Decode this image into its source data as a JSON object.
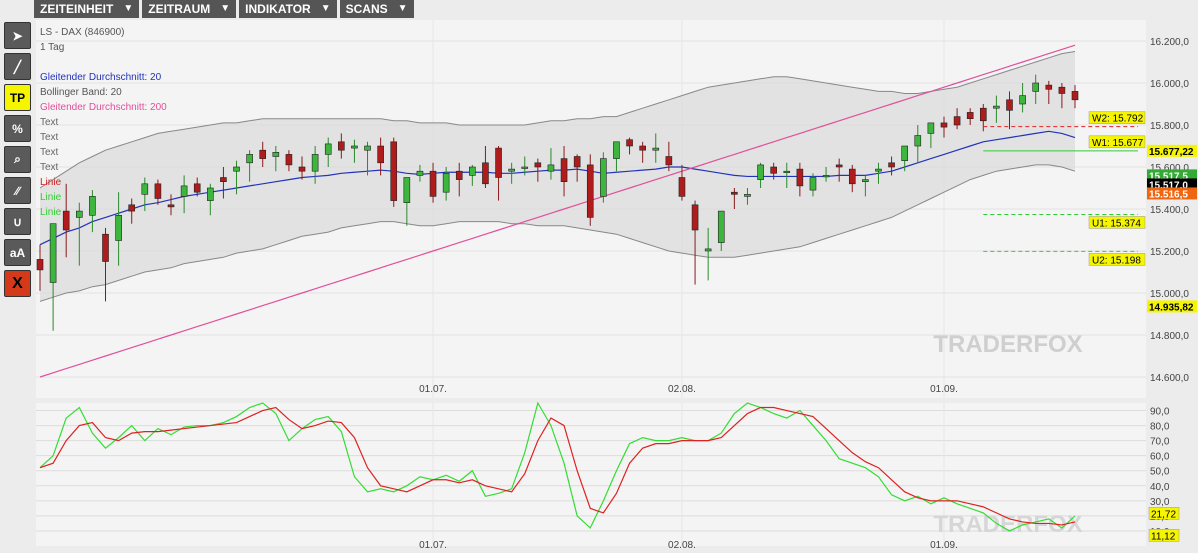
{
  "menus": [
    {
      "label": "ZEITEINHEIT",
      "name": "menu-zeiteinheit"
    },
    {
      "label": "ZEITRAUM",
      "name": "menu-zeitraum"
    },
    {
      "label": "INDIKATOR",
      "name": "menu-indikator"
    },
    {
      "label": "SCANS",
      "name": "menu-scans"
    }
  ],
  "tools": [
    {
      "name": "cursor-tool-icon",
      "glyph": "➤"
    },
    {
      "name": "line-tool-icon",
      "glyph": "╱"
    },
    {
      "name": "tp-tool-button",
      "glyph": "TP",
      "style": "tp"
    },
    {
      "name": "percent-tool-icon",
      "glyph": "%"
    },
    {
      "name": "zoom-tool-icon",
      "glyph": "⌕"
    },
    {
      "name": "channel-tool-icon",
      "glyph": "∕∕"
    },
    {
      "name": "curve-tool-icon",
      "glyph": "∪"
    },
    {
      "name": "text-size-tool-button",
      "glyph": "aA"
    },
    {
      "name": "delete-tool-icon",
      "glyph": "X",
      "style": "del"
    }
  ],
  "instrument": {
    "title": "LS - DAX (846900)",
    "period": "1 Tag"
  },
  "legend": [
    {
      "text": "Gleitender Durchschnitt: 20",
      "color": "#2233bb"
    },
    {
      "text": "Bollinger Band: 20",
      "color": "#555555"
    },
    {
      "text": "Gleitender Durchschnitt: 200",
      "color": "#e0509a"
    },
    {
      "text": "Text",
      "color": "#666666"
    },
    {
      "text": "Text",
      "color": "#666666"
    },
    {
      "text": "Text",
      "color": "#666666"
    },
    {
      "text": "Text",
      "color": "#666666"
    },
    {
      "text": "Linie",
      "color": "#cc2222"
    },
    {
      "text": "Linie",
      "color": "#33cc33"
    },
    {
      "text": "Linie",
      "color": "#33cc33"
    }
  ],
  "watermark": "TRADERFOX",
  "chart_data": [
    {
      "type": "candlestick",
      "ylim": [
        14500,
        16300
      ],
      "yticks": [
        {
          "v": 16200,
          "l": "16.200,0"
        },
        {
          "v": 16000,
          "l": "16.000,0"
        },
        {
          "v": 15800,
          "l": "15.800,0"
        },
        {
          "v": 15600,
          "l": "15.600,0"
        },
        {
          "v": 15400,
          "l": "15.400,0"
        },
        {
          "v": 15200,
          "l": "15.200,0"
        },
        {
          "v": 15000,
          "l": "15.000,0"
        },
        {
          "v": 14800,
          "l": "14.800,0"
        },
        {
          "v": 14600,
          "l": "14.600,0"
        }
      ],
      "xticks": [
        {
          "i": 30,
          "l": "01.07."
        },
        {
          "i": 49,
          "l": "02.08."
        },
        {
          "i": 69,
          "l": "01.09."
        }
      ],
      "n": 80,
      "ohlc": [
        [
          15160,
          15230,
          15010,
          15110
        ],
        [
          15050,
          15280,
          14820,
          15330
        ],
        [
          15390,
          15520,
          15170,
          15300
        ],
        [
          15360,
          15430,
          15130,
          15390
        ],
        [
          15370,
          15490,
          15290,
          15460
        ],
        [
          15280,
          15310,
          14960,
          15150
        ],
        [
          15250,
          15480,
          15130,
          15370
        ],
        [
          15420,
          15450,
          15330,
          15390
        ],
        [
          15470,
          15550,
          15390,
          15520
        ],
        [
          15520,
          15540,
          15420,
          15450
        ],
        [
          15420,
          15470,
          15370,
          15410
        ],
        [
          15460,
          15560,
          15380,
          15510
        ],
        [
          15520,
          15550,
          15460,
          15480
        ],
        [
          15440,
          15520,
          15370,
          15500
        ],
        [
          15550,
          15600,
          15450,
          15530
        ],
        [
          15580,
          15630,
          15470,
          15600
        ],
        [
          15620,
          15680,
          15530,
          15660
        ],
        [
          15680,
          15720,
          15600,
          15640
        ],
        [
          15650,
          15700,
          15580,
          15670
        ],
        [
          15660,
          15680,
          15580,
          15610
        ],
        [
          15600,
          15650,
          15540,
          15580
        ],
        [
          15580,
          15700,
          15520,
          15660
        ],
        [
          15660,
          15740,
          15600,
          15710
        ],
        [
          15720,
          15760,
          15640,
          15680
        ],
        [
          15690,
          15730,
          15620,
          15700
        ],
        [
          15680,
          15720,
          15560,
          15700
        ],
        [
          15700,
          15740,
          15560,
          15620
        ],
        [
          15720,
          15740,
          15410,
          15440
        ],
        [
          15430,
          15470,
          15320,
          15550
        ],
        [
          15560,
          15610,
          15530,
          15580
        ],
        [
          15580,
          15620,
          15430,
          15460
        ],
        [
          15480,
          15600,
          15440,
          15570
        ],
        [
          15580,
          15620,
          15460,
          15540
        ],
        [
          15560,
          15610,
          15510,
          15600
        ],
        [
          15620,
          15700,
          15500,
          15520
        ],
        [
          15690,
          15700,
          15440,
          15550
        ],
        [
          15580,
          15620,
          15520,
          15590
        ],
        [
          15600,
          15650,
          15560,
          15600
        ],
        [
          15620,
          15640,
          15530,
          15600
        ],
        [
          15580,
          15690,
          15540,
          15610
        ],
        [
          15640,
          15700,
          15460,
          15530
        ],
        [
          15650,
          15660,
          15530,
          15600
        ],
        [
          15610,
          15660,
          15320,
          15360
        ],
        [
          15460,
          15670,
          15430,
          15640
        ],
        [
          15640,
          15710,
          15580,
          15720
        ],
        [
          15730,
          15740,
          15660,
          15700
        ],
        [
          15700,
          15720,
          15620,
          15680
        ],
        [
          15680,
          15760,
          15620,
          15690
        ],
        [
          15650,
          15720,
          15580,
          15610
        ],
        [
          15550,
          15610,
          15440,
          15460
        ],
        [
          15420,
          15440,
          15040,
          15300
        ],
        [
          15200,
          15310,
          15060,
          15210
        ],
        [
          15240,
          15380,
          15200,
          15390
        ],
        [
          15480,
          15500,
          15400,
          15470
        ],
        [
          15460,
          15500,
          15420,
          15470
        ],
        [
          15540,
          15620,
          15500,
          15610
        ],
        [
          15600,
          15620,
          15540,
          15570
        ],
        [
          15580,
          15620,
          15500,
          15580
        ],
        [
          15590,
          15620,
          15460,
          15510
        ],
        [
          15490,
          15570,
          15460,
          15550
        ],
        [
          15560,
          15600,
          15530,
          15560
        ],
        [
          15610,
          15640,
          15530,
          15600
        ],
        [
          15590,
          15610,
          15480,
          15520
        ],
        [
          15530,
          15560,
          15460,
          15540
        ],
        [
          15580,
          15620,
          15520,
          15590
        ],
        [
          15620,
          15650,
          15560,
          15600
        ],
        [
          15630,
          15700,
          15580,
          15700
        ],
        [
          15700,
          15800,
          15620,
          15750
        ],
        [
          15760,
          15800,
          15690,
          15810
        ],
        [
          15810,
          15840,
          15740,
          15790
        ],
        [
          15840,
          15880,
          15780,
          15800
        ],
        [
          15860,
          15880,
          15800,
          15830
        ],
        [
          15880,
          15900,
          15770,
          15820
        ],
        [
          15880,
          15940,
          15810,
          15890
        ],
        [
          15920,
          15960,
          15780,
          15870
        ],
        [
          15900,
          16000,
          15860,
          15940
        ],
        [
          15960,
          16040,
          15900,
          16000
        ],
        [
          15990,
          16010,
          15900,
          15970
        ],
        [
          15980,
          16000,
          15880,
          15950
        ],
        [
          15960,
          15990,
          15880,
          15920
        ]
      ]
    },
    {
      "type": "line",
      "name": "stochastic",
      "ylim": [
        0,
        95
      ],
      "yticks": [
        {
          "v": 90,
          "l": "90,0"
        },
        {
          "v": 80,
          "l": "80,0"
        },
        {
          "v": 70,
          "l": "70,0"
        },
        {
          "v": 60,
          "l": "60,0"
        },
        {
          "v": 50,
          "l": "50,0"
        },
        {
          "v": 40,
          "l": "40,0"
        },
        {
          "v": 30,
          "l": "30,0"
        },
        {
          "v": 20,
          "l": "20,0"
        },
        {
          "v": 10,
          "l": "10,0"
        }
      ],
      "series": [
        {
          "color": "#33dd33",
          "values": [
            52,
            60,
            85,
            92,
            75,
            65,
            72,
            80,
            70,
            78,
            74,
            79,
            80,
            80,
            82,
            86,
            92,
            95,
            88,
            70,
            78,
            84,
            86,
            76,
            46,
            36,
            38,
            36,
            40,
            46,
            44,
            47,
            43,
            50,
            33,
            35,
            38,
            62,
            95,
            80,
            55,
            20,
            12,
            30,
            50,
            68,
            72,
            70,
            70,
            72,
            70,
            70,
            75,
            88,
            95,
            92,
            88,
            85,
            90,
            80,
            70,
            58,
            55,
            52,
            46,
            34,
            30,
            33,
            28,
            32,
            28,
            25,
            22,
            15,
            10,
            14,
            16,
            18,
            12,
            20
          ]
        },
        {
          "color": "#dd2222",
          "values": [
            52,
            55,
            70,
            80,
            82,
            72,
            70,
            75,
            76,
            76,
            77,
            78,
            79,
            80,
            81,
            82,
            86,
            90,
            92,
            84,
            78,
            80,
            83,
            82,
            72,
            52,
            40,
            38,
            36,
            40,
            44,
            44,
            42,
            44,
            40,
            38,
            36,
            48,
            70,
            85,
            80,
            50,
            25,
            22,
            35,
            55,
            65,
            68,
            68,
            70,
            70,
            70,
            72,
            80,
            88,
            92,
            92,
            90,
            88,
            86,
            78,
            70,
            62,
            56,
            52,
            44,
            36,
            32,
            30,
            30,
            30,
            28,
            26,
            22,
            18,
            16,
            15,
            15,
            14,
            16
          ]
        }
      ]
    }
  ],
  "overlays": {
    "ma20": [
      15230,
      15260,
      15290,
      15310,
      15340,
      15360,
      15380,
      15400,
      15420,
      15430,
      15445,
      15460,
      15470,
      15480,
      15490,
      15500,
      15510,
      15520,
      15530,
      15540,
      15550,
      15555,
      15560,
      15570,
      15575,
      15580,
      15585,
      15580,
      15570,
      15565,
      15570,
      15575,
      15575,
      15575,
      15575,
      15570,
      15570,
      15575,
      15580,
      15585,
      15585,
      15590,
      15580,
      15570,
      15575,
      15580,
      15585,
      15590,
      15600,
      15600,
      15590,
      15580,
      15570,
      15560,
      15555,
      15555,
      15555,
      15555,
      15555,
      15555,
      15555,
      15560,
      15560,
      15560,
      15570,
      15580,
      15600,
      15620,
      15640,
      15660,
      15680,
      15700,
      15720,
      15730,
      15740,
      15750,
      15760,
      15770,
      15760,
      15740
    ],
    "boll_upper": [
      15500,
      15540,
      15580,
      15620,
      15650,
      15680,
      15700,
      15720,
      15740,
      15760,
      15770,
      15780,
      15790,
      15800,
      15810,
      15810,
      15820,
      15830,
      15830,
      15830,
      15830,
      15830,
      15830,
      15830,
      15830,
      15830,
      15830,
      15820,
      15820,
      15810,
      15810,
      15810,
      15800,
      15800,
      15800,
      15800,
      15800,
      15800,
      15810,
      15820,
      15820,
      15830,
      15830,
      15840,
      15840,
      15860,
      15880,
      15900,
      15920,
      15940,
      15960,
      15980,
      15990,
      16000,
      16010,
      16020,
      16030,
      16030,
      16020,
      16010,
      16000,
      15990,
      15980,
      15970,
      15960,
      15960,
      15950,
      15950,
      15960,
      15970,
      15980,
      16000,
      16020,
      16040,
      16060,
      16080,
      16100,
      16120,
      16140,
      16150
    ],
    "boll_lower": [
      14960,
      14980,
      15000,
      15010,
      15030,
      15040,
      15060,
      15080,
      15100,
      15110,
      15120,
      15140,
      15150,
      15160,
      15170,
      15190,
      15200,
      15210,
      15230,
      15250,
      15270,
      15280,
      15290,
      15310,
      15320,
      15330,
      15340,
      15340,
      15330,
      15320,
      15320,
      15330,
      15340,
      15340,
      15340,
      15340,
      15330,
      15330,
      15320,
      15320,
      15320,
      15310,
      15300,
      15290,
      15280,
      15260,
      15240,
      15220,
      15200,
      15190,
      15180,
      15170,
      15170,
      15170,
      15180,
      15190,
      15200,
      15210,
      15220,
      15240,
      15260,
      15280,
      15300,
      15320,
      15340,
      15360,
      15390,
      15420,
      15450,
      15480,
      15510,
      15540,
      15560,
      15580,
      15590,
      15600,
      15610,
      15610,
      15600,
      15580
    ],
    "ma200": [
      14600,
      14620,
      14640,
      14660,
      14680,
      14700,
      14720,
      14740,
      14760,
      14780,
      14800,
      14820,
      14840,
      14860,
      14880,
      14900,
      14920,
      14940,
      14960,
      14980,
      15000,
      15020,
      15040,
      15060,
      15080,
      15100,
      15120,
      15140,
      15160,
      15180,
      15200,
      15220,
      15240,
      15260,
      15280,
      15300,
      15320,
      15340,
      15360,
      15380,
      15400,
      15420,
      15440,
      15460,
      15480,
      15500,
      15520,
      15540,
      15560,
      15580,
      15600,
      15620,
      15640,
      15660,
      15680,
      15700,
      15720,
      15740,
      15760,
      15780,
      15800,
      15820,
      15840,
      15860,
      15880,
      15900,
      15920,
      15940,
      15960,
      15980,
      16000,
      16020,
      16040,
      16060,
      16080,
      16100,
      16120,
      16140,
      16160,
      16180
    ],
    "levels": [
      {
        "label": "W2: 15.792",
        "value": 15792,
        "color": "#dd2222",
        "dashed": true
      },
      {
        "label": "W1: 15.677",
        "value": 15677,
        "color": "#33cc33"
      },
      {
        "label": "U1: 15.374",
        "value": 15374,
        "color": "#33cc33",
        "dashed": true
      },
      {
        "label": "U2: 15.198",
        "value": 15198,
        "color": "#33cc33",
        "dashed": true
      }
    ],
    "price_tags": [
      {
        "label": "15.677,22",
        "value": 15677,
        "bg": "#f5f500",
        "fg": "#000"
      },
      {
        "label": "15.517,5",
        "value": 15560,
        "bg": "#33aa33",
        "fg": "#fff"
      },
      {
        "label": "15.517,0",
        "value": 15517,
        "bg": "#000000",
        "fg": "#fff"
      },
      {
        "label": "15.516,5",
        "value": 15474,
        "bg": "#ee6611",
        "fg": "#fff"
      },
      {
        "label": "14.935,82",
        "value": 14936,
        "bg": "#f5f500",
        "fg": "#000"
      }
    ],
    "stoch_tags": [
      {
        "label": "21,72",
        "value": 21.72,
        "bg": "#f5f500",
        "fg": "#000"
      },
      {
        "label": "11,12",
        "value": 11.12,
        "bg": "#f5f500",
        "fg": "#000"
      }
    ]
  }
}
